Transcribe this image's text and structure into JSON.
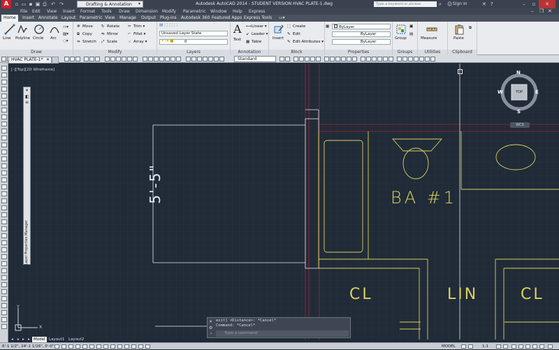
{
  "titlebar": {
    "workspace": "Drafting & Annotation",
    "title": "Autodesk AutoCAD 2014 - STUDENT VERSION    HVAC PLATE-1.dwg",
    "search_placeholder": "Type a keyword or phrase",
    "signin": "Sign In"
  },
  "menu": [
    "File",
    "Edit",
    "View",
    "Insert",
    "Format",
    "Tools",
    "Draw",
    "Dimension",
    "Modify",
    "Parametric",
    "Window",
    "Help",
    "Express"
  ],
  "ribbon_tabs": [
    "Home",
    "Insert",
    "Annotate",
    "Layout",
    "Parametric",
    "View",
    "Manage",
    "Output",
    "Plug-ins",
    "Autodesk 360",
    "Featured Apps",
    "Express Tools"
  ],
  "ribbon": {
    "draw": {
      "title": "Draw",
      "line": "Line",
      "polyline": "Polyline",
      "circle": "Circle",
      "arc": "Arc"
    },
    "modify": {
      "title": "Modify",
      "move": "Move",
      "rotate": "Rotate",
      "trim": "Trim",
      "copy": "Copy",
      "mirror": "Mirror",
      "fillet": "Fillet",
      "stretch": "Stretch",
      "scale": "Scale",
      "array": "Array"
    },
    "layers": {
      "title": "Layers",
      "layer_state": "Unsaved Layer State",
      "current_layer": "0"
    },
    "annotation": {
      "title": "Annotation",
      "text": "Text",
      "linear": "Linear",
      "leader": "Leader",
      "table": "Table"
    },
    "block": {
      "title": "Block",
      "insert": "Insert",
      "create": "Create",
      "edit": "Edit",
      "edit_attributes": "Edit Attributes"
    },
    "properties": {
      "title": "Properties",
      "color": "ByLayer",
      "linetype": "ByLayer",
      "lineweight": "ByLayer"
    },
    "groups": {
      "title": "Groups",
      "group": "Group"
    },
    "utilities": {
      "title": "Utilities",
      "measure": "Measure"
    },
    "clipboard": {
      "title": "Clipboard",
      "paste": "Paste"
    }
  },
  "toolbar": {
    "text_style": "Standard"
  },
  "doc": {
    "tab": "HVAC PLATE-1*"
  },
  "viewport_label": "[-][Top][2D Wireframe]",
  "layer_palette": {
    "title": "Layer Properties Manager"
  },
  "viewcube": {
    "n": "N",
    "s": "S",
    "e": "E",
    "w": "W",
    "face": "TOP",
    "wcs": "WCS"
  },
  "drawing": {
    "room1": "BA #1",
    "room2": "CL",
    "room3": "LIN",
    "room4": "CL",
    "dim": "5'-5\""
  },
  "command": {
    "line1": "exit] <Distance>: *Cancel*",
    "line2": "Command: *Cancel*",
    "placeholder": "Type a command"
  },
  "layout_tabs": [
    "Model",
    "Layout1",
    "Layout2"
  ],
  "status": {
    "coords": "6'-1 1/2\",  24'-1 1/16\", 0'-0\"",
    "model": "MODEL",
    "scale": "1:1"
  },
  "colors": {
    "background": "#212b38",
    "grid": "#2a3645",
    "yellow": "#d8d35a",
    "red": "#b0202a",
    "white": "#e6e8ea"
  }
}
